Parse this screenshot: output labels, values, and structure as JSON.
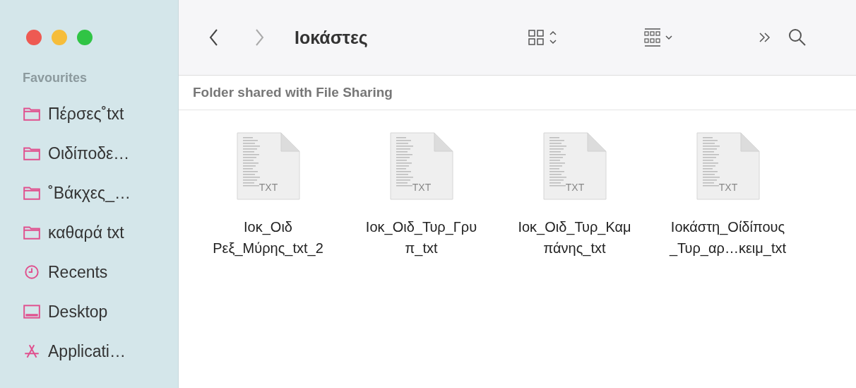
{
  "window": {
    "title": "Ιοκάστες"
  },
  "sidebar": {
    "heading": "Favourites",
    "items": [
      {
        "kind": "folder",
        "label": "Πέρσες˚txt"
      },
      {
        "kind": "folder",
        "label": "Οιδίποδε…"
      },
      {
        "kind": "folder",
        "label": "˚Βάκχες_…"
      },
      {
        "kind": "folder",
        "label": "καθαρά txt"
      },
      {
        "kind": "recents",
        "label": "Recents"
      },
      {
        "kind": "desktop",
        "label": "Desktop"
      },
      {
        "kind": "applications",
        "label": "Applicati…"
      }
    ]
  },
  "banner": "Folder shared with File Sharing",
  "files": [
    {
      "badge": "TXT",
      "name": [
        "Ιοκ_Οιδ",
        "Ρεξ_Μύρης_txt_2"
      ]
    },
    {
      "badge": "TXT",
      "name": [
        "Ιοκ_Οιδ_Τυρ_Γρυ",
        "π_txt"
      ]
    },
    {
      "badge": "TXT",
      "name": [
        "Ιοκ_Οιδ_Τυρ_Καμ",
        "πάνης_txt"
      ]
    },
    {
      "badge": "TXT",
      "name": [
        "Ιοκάστη_Οίδίπους",
        "_Τυρ_αρ…κειμ_txt"
      ]
    }
  ]
}
